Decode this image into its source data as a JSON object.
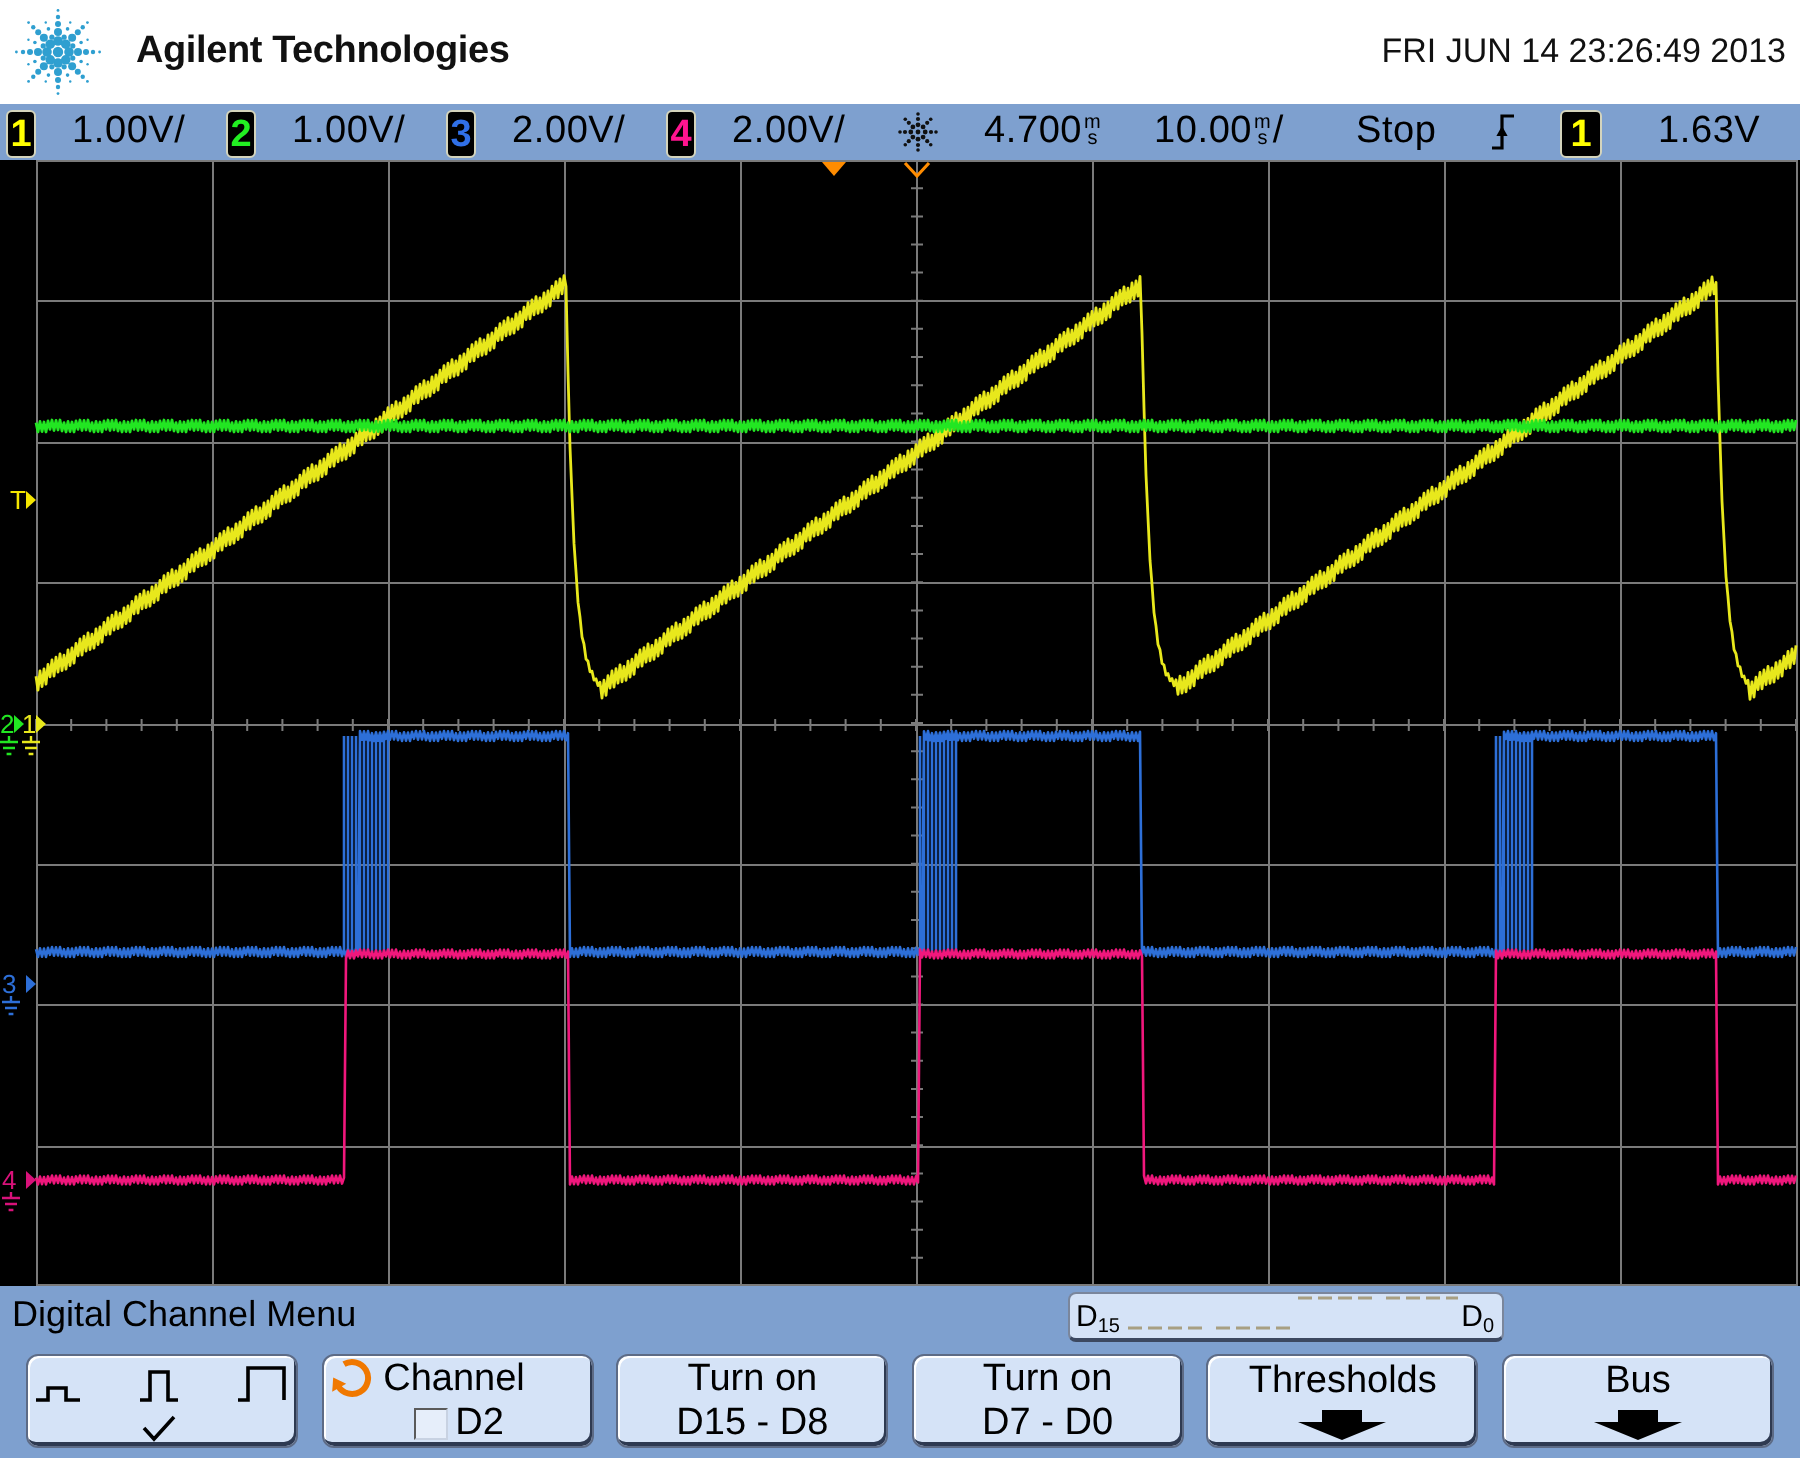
{
  "header": {
    "brand": "Agilent Technologies",
    "datetime": "FRI JUN 14 23:26:49 2013"
  },
  "status_bar": {
    "channels": [
      {
        "number": "1",
        "scale": "1.00V/",
        "color": "#ffff00"
      },
      {
        "number": "2",
        "scale": "1.00V/",
        "color": "#22ee22"
      },
      {
        "number": "3",
        "scale": "2.00V/",
        "color": "#3070e8"
      },
      {
        "number": "4",
        "scale": "2.00V/",
        "color": "#ff1490"
      }
    ],
    "delay": {
      "value": "4.700",
      "unit_top": "m",
      "unit_bottom": "s"
    },
    "timebase": {
      "value": "10.00",
      "unit_top": "m",
      "unit_bottom": "s",
      "suffix": "/"
    },
    "run_state": "Stop",
    "trigger": {
      "source": "1",
      "color": "#ffff00",
      "level": "1.63V"
    }
  },
  "display": {
    "traces": [
      {
        "kind": "sawtooth",
        "color": "#e8e81c"
      },
      {
        "kind": "flat",
        "color": "#22e622"
      },
      {
        "kind": "pulse",
        "color": "#2d6fd8"
      },
      {
        "kind": "square",
        "color": "#f0177c"
      }
    ],
    "markers": [
      {
        "kind": "trigger",
        "label": "T",
        "color": "#f5e600"
      },
      {
        "kind": "ground",
        "label": "2",
        "color": "#22e622"
      },
      {
        "kind": "ground",
        "label": "1",
        "color": "#e8e81c"
      },
      {
        "kind": "ground",
        "label": "3",
        "color": "#2d6fd8"
      },
      {
        "kind": "ground",
        "label": "4",
        "color": "#d8127a"
      }
    ]
  },
  "menu": {
    "title": "Digital Channel Menu",
    "bit_range": {
      "high": "D$_{15}$",
      "low": "D$_{0}$"
    },
    "softkeys": [
      {
        "kind": "size",
        "options": [
          {
            "selected": false
          },
          {
            "selected": true
          },
          {
            "selected": false
          }
        ]
      },
      {
        "kind": "channel",
        "label": "Channel",
        "checked": false,
        "value": "D2"
      },
      {
        "kind": "text",
        "lines": [
          "Turn on",
          "D15 - D8"
        ]
      },
      {
        "kind": "text",
        "lines": [
          "Turn on",
          "D7 - D0"
        ]
      },
      {
        "kind": "submenu",
        "label": "Thresholds"
      },
      {
        "kind": "submenu",
        "label": "Bus"
      }
    ]
  }
}
